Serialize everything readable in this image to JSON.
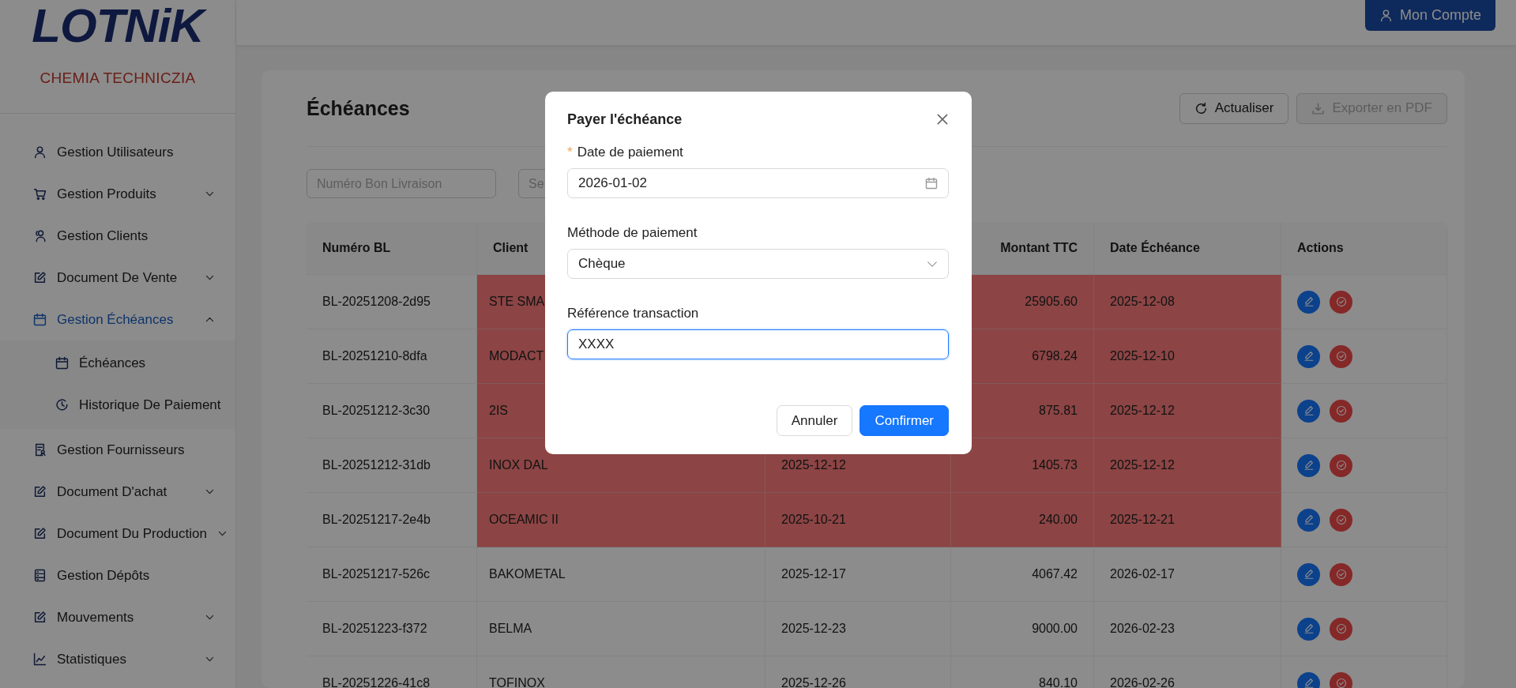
{
  "brand": {
    "logo": "LOTNiK",
    "subtitle": "CHEMIA TECHNICZIA"
  },
  "sidebar": {
    "items": [
      {
        "label": "Gestion Utilisateurs",
        "selected": false
      },
      {
        "label": "Gestion Produits",
        "selected": false,
        "expanded": false
      },
      {
        "label": "Gestion Clients",
        "selected": false
      },
      {
        "label": "Document De Vente",
        "selected": false,
        "expanded": false
      },
      {
        "label": "Gestion Échéances",
        "selected": true,
        "expanded": true,
        "children": [
          {
            "label": "Échéances"
          },
          {
            "label": "Historique De Paiement"
          }
        ]
      },
      {
        "label": "Gestion Fournisseurs",
        "selected": false
      },
      {
        "label": "Document D'achat",
        "selected": false,
        "expanded": false
      },
      {
        "label": "Document Du Production",
        "selected": false,
        "expanded": false
      },
      {
        "label": "Gestion Dépôts",
        "selected": false
      },
      {
        "label": "Mouvements",
        "selected": false,
        "expanded": false
      },
      {
        "label": "Statistiques",
        "selected": false,
        "expanded": false
      }
    ]
  },
  "header": {
    "account_button": "Mon Compte"
  },
  "page": {
    "title": "Échéances",
    "buttons": [
      {
        "label": "Actualiser",
        "disabled": false
      },
      {
        "label": "Exporter en PDF",
        "disabled": true
      }
    ],
    "filters": [
      {
        "placeholder": "Numéro Bon Livraison"
      },
      {
        "placeholder": "Se"
      }
    ]
  },
  "table": {
    "columns": [
      "Numéro BL",
      "Client",
      null,
      "Montant TTC",
      "Date Échéance",
      "Actions"
    ],
    "rows": [
      {
        "cells": [
          "BL-20251208-2d95",
          "STE SMA",
          null,
          "25905.60",
          "2025-12-08"
        ],
        "overdue": true
      },
      {
        "cells": [
          "BL-20251210-8dfa",
          "MODACT",
          null,
          "6798.24",
          "2025-12-10"
        ],
        "overdue": true
      },
      {
        "cells": [
          "BL-20251212-3c30",
          "2IS",
          null,
          "875.81",
          "2025-12-12"
        ],
        "overdue": true
      },
      {
        "cells": [
          "BL-20251212-31db",
          "INOX DAL",
          "2025-12-12",
          "1405.73",
          "2025-12-12"
        ],
        "overdue": true
      },
      {
        "cells": [
          "BL-20251217-2e4b",
          "OCEAMIC II",
          "2025-10-21",
          "240.00",
          "2025-12-21"
        ],
        "overdue": true
      },
      {
        "cells": [
          "BL-20251217-526c",
          "BAKOMETAL",
          "2025-12-17",
          "4067.42",
          "2026-02-17"
        ],
        "overdue": false
      },
      {
        "cells": [
          "BL-20251223-f372",
          "BELMA",
          "2025-12-23",
          "9000.00",
          "2026-02-23"
        ],
        "overdue": false
      },
      {
        "cells": [
          "BL-20251226-41c8",
          "TOFINOX",
          "2025-12-26",
          "840.10",
          "2026-02-26"
        ],
        "overdue": false
      }
    ]
  },
  "modal": {
    "title": "Payer l'échéance",
    "fields": [
      {
        "kind": "date",
        "label": "Date de paiement",
        "required_mark": "*",
        "value": "2026-01-02",
        "focused": false
      },
      {
        "kind": "select",
        "label": "Méthode de paiement",
        "value": "Chèque",
        "focused": false
      },
      {
        "kind": "text",
        "label": "Référence transaction",
        "value": "XXXX",
        "focused": true
      }
    ],
    "buttons": [
      {
        "label": "Annuler",
        "primary": false
      },
      {
        "label": "Confirmer",
        "primary": true
      }
    ]
  }
}
